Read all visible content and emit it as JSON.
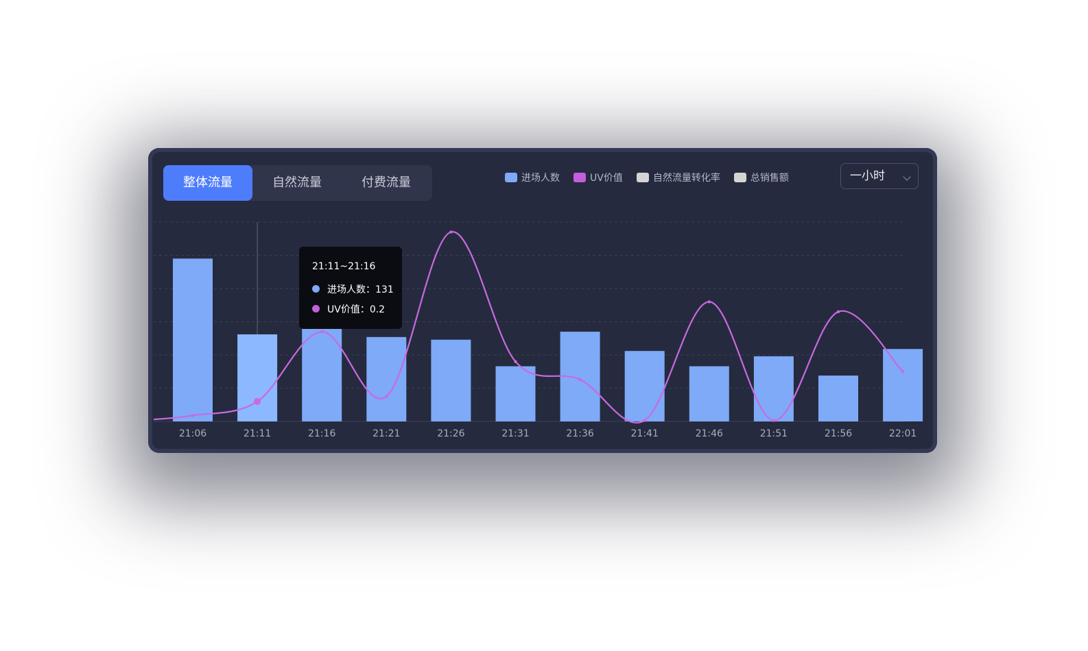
{
  "tabs": [
    {
      "label": "整体流量",
      "active": true
    },
    {
      "label": "自然流量",
      "active": false
    },
    {
      "label": "付费流量",
      "active": false
    }
  ],
  "legend": [
    {
      "label": "进场人数",
      "color": "#7eaaf7"
    },
    {
      "label": "UV价值",
      "color": "#c35fdc"
    },
    {
      "label": "自然流量转化率",
      "color": "#d4d4d4"
    },
    {
      "label": "总销售额",
      "color": "#d4d4d4"
    }
  ],
  "range_select": {
    "value": "一小时",
    "icon": "chevron-down-icon"
  },
  "tooltip": {
    "title": "21:11~21:16",
    "rows": [
      {
        "text": "进场人数：131",
        "color": "#7eaaf7"
      },
      {
        "text": "UV价值：0.2",
        "color": "#c35fdc"
      }
    ]
  },
  "colors": {
    "bar": "#7eaaf7",
    "bar_highlight": "#8bb8ff",
    "line": "#c86ae0",
    "grid": "#3b4058",
    "tick": "#a9aebd"
  },
  "chart_data": {
    "type": "bar",
    "categories": [
      "21:06",
      "21:11",
      "21:16",
      "21:21",
      "21:26",
      "21:31",
      "21:36",
      "21:41",
      "21:46",
      "21:51",
      "21:56",
      "22:01"
    ],
    "series": [
      {
        "name": "进场人数",
        "type": "bar",
        "values": [
          245,
          131,
          157,
          127,
          123,
          83,
          135,
          106,
          83,
          98,
          69,
          109
        ]
      },
      {
        "name": "UV价值",
        "type": "line",
        "values": [
          0.06,
          0.2,
          0.9,
          0.25,
          1.9,
          0.6,
          0.42,
          0.01,
          1.2,
          0.01,
          1.1,
          0.5
        ]
      }
    ],
    "ylim": [
      0,
      300
    ],
    "grid": true,
    "highlight_index": 1
  }
}
